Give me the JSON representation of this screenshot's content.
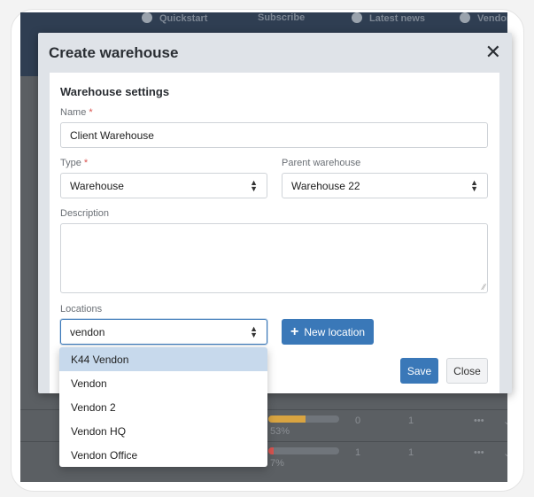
{
  "background": {
    "nav": [
      {
        "label": "Quickstart"
      },
      {
        "label": "Subscribe"
      },
      {
        "label": "Latest news"
      },
      {
        "label": "Vendon"
      }
    ],
    "rows": [
      {
        "percent": "53%",
        "col_a": "0",
        "col_b": "1",
        "bar_fill": 0.53,
        "bar_color": "#d9a441"
      },
      {
        "percent": "7%",
        "col_a": "1",
        "col_b": "1",
        "bar_fill": 0.07,
        "bar_color": "#d9534f"
      }
    ],
    "more_label": "•••",
    "chevron": "⌄"
  },
  "modal": {
    "title": "Create warehouse",
    "close_glyph": "✕",
    "section_title": "Warehouse settings",
    "name": {
      "label": "Name",
      "required": "*",
      "value": "Client Warehouse"
    },
    "type": {
      "label": "Type",
      "required": "*",
      "value": "Warehouse"
    },
    "parent": {
      "label": "Parent warehouse",
      "value": "Warehouse 22"
    },
    "description": {
      "label": "Description",
      "value": ""
    },
    "locations": {
      "label": "Locations",
      "value": "vendon"
    },
    "new_location_label": "New location",
    "save_label": "Save",
    "close_label": "Close"
  },
  "dropdown": {
    "options": [
      "K44 Vendon",
      "Vendon",
      "Vendon 2",
      "Vendon HQ",
      "Vendon Office"
    ],
    "highlighted_index": 0
  },
  "colors": {
    "primary": "#3a78b8",
    "required": "#d9534f",
    "highlight": "#c7d9ec"
  }
}
